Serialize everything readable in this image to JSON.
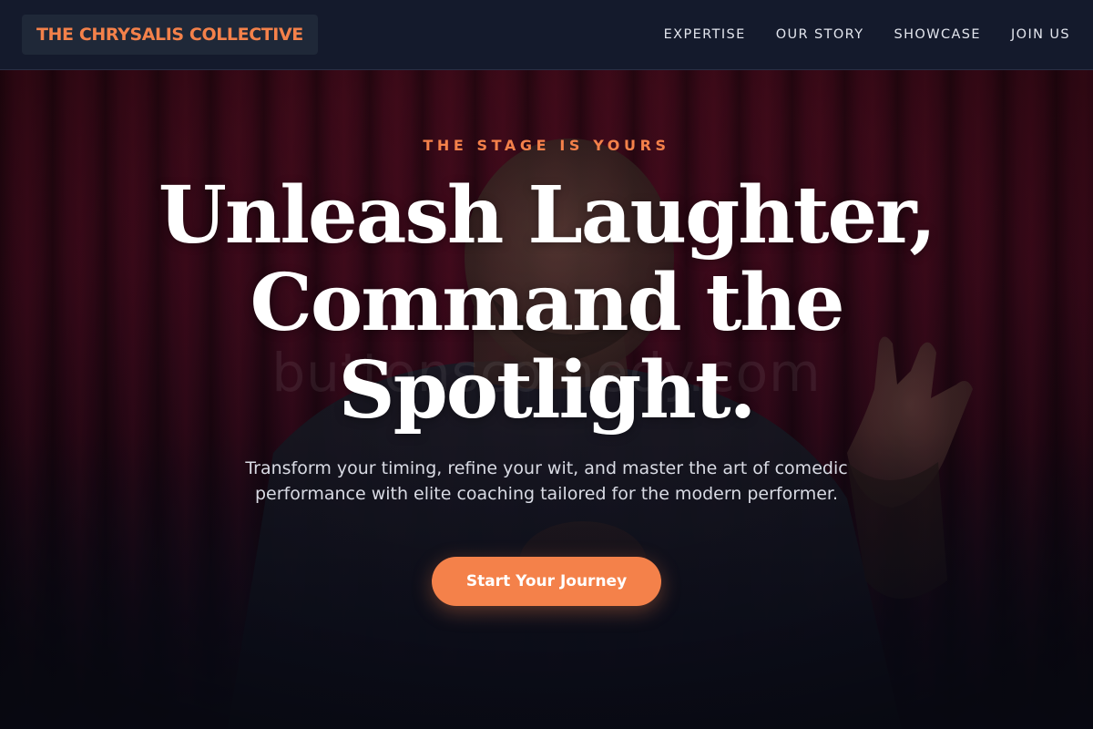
{
  "header": {
    "brand": "THE CHRYSALIS COLLECTIVE",
    "nav": [
      "EXPERTISE",
      "OUR STORY",
      "SHOWCASE",
      "JOIN US"
    ]
  },
  "hero": {
    "eyebrow": "THE STAGE IS YOURS",
    "headline_lines": [
      "Unleash Laughter,",
      "Command the",
      "Spotlight."
    ],
    "subtext": "Transform your timing, refine your wit, and master the art of comedic performance with elite coaching tailored for the modern performer.",
    "cta": "Start Your Journey",
    "watermark": "buttonscomedy.com"
  },
  "colors": {
    "accent": "#f4814a",
    "header_bg": "#141a2c",
    "curtain": "#5a0d22"
  }
}
